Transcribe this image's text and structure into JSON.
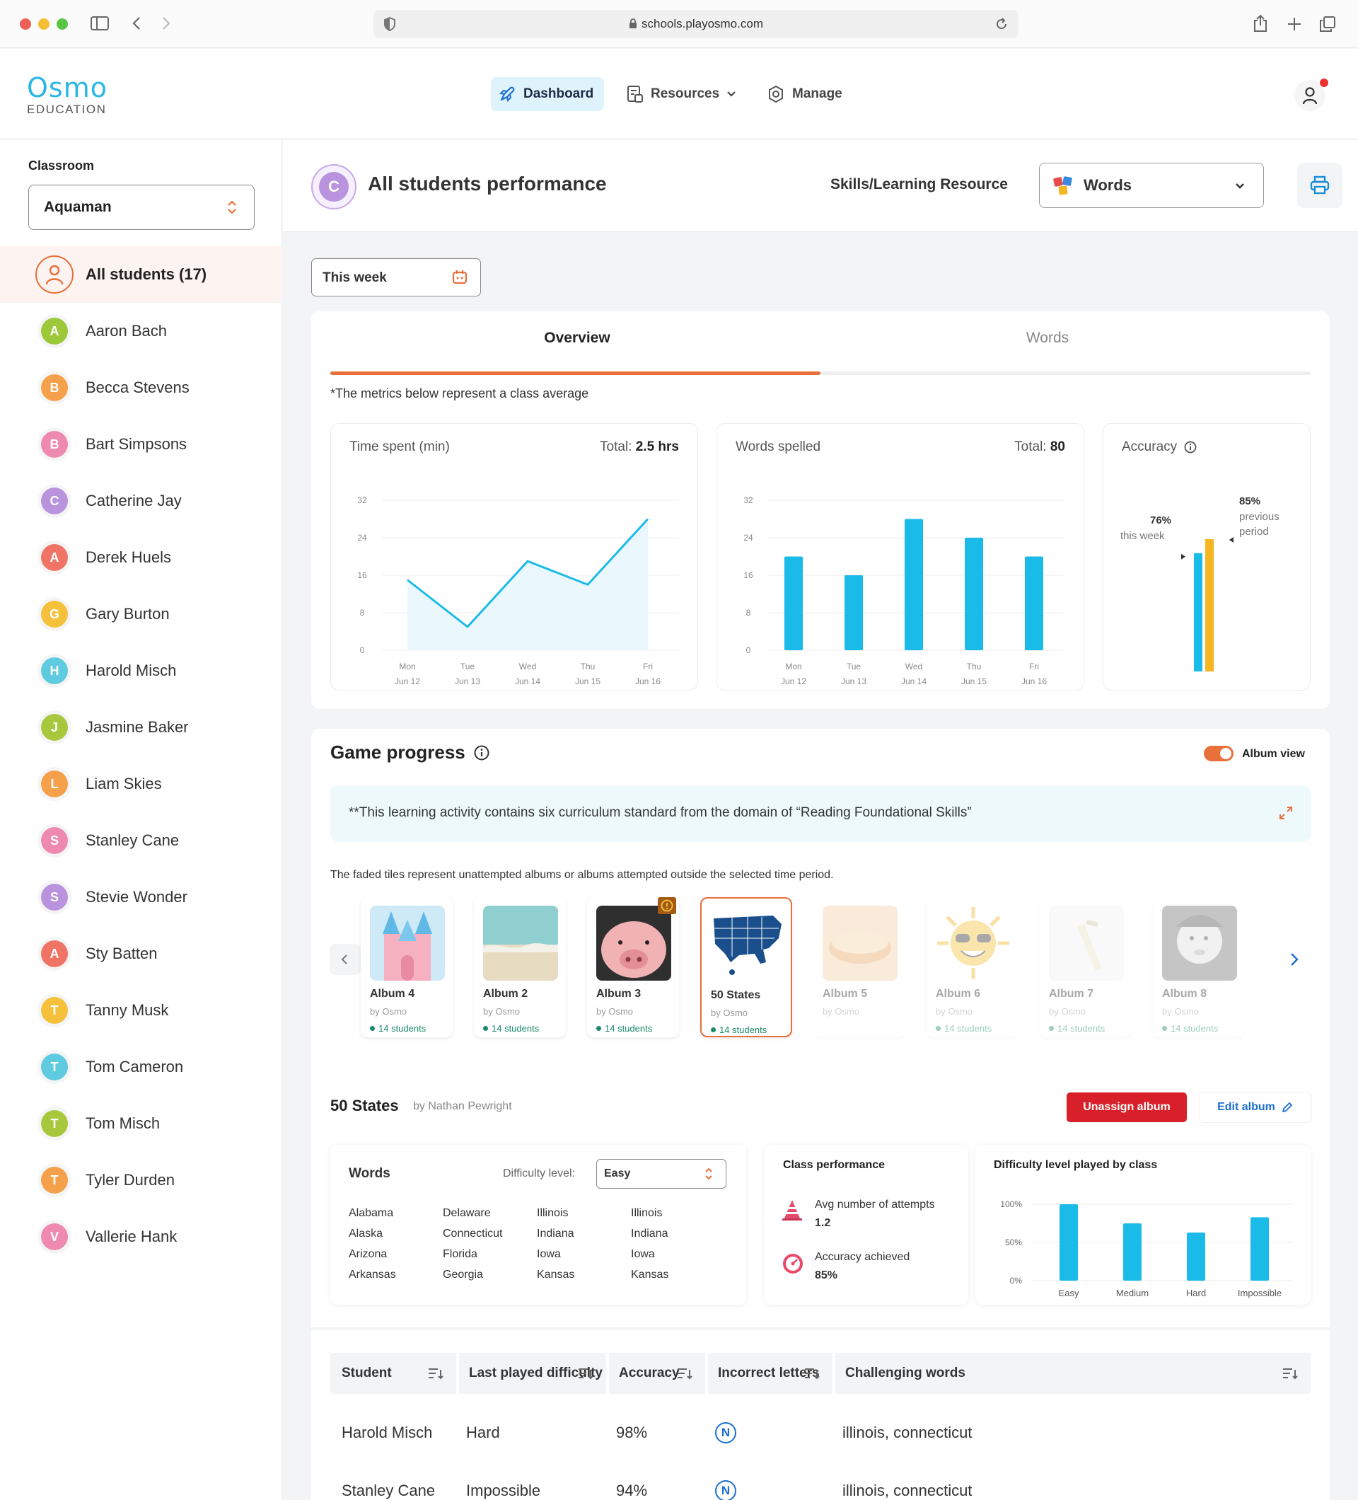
{
  "browser": {
    "url": "schools.playosmo.com"
  },
  "brand": {
    "logo_main": "Osmo",
    "logo_sub": "EDUCATION"
  },
  "nav": {
    "dashboard": "Dashboard",
    "resources": "Resources",
    "manage": "Manage"
  },
  "sidebar": {
    "classroom_label": "Classroom",
    "classroom_value": "Aquaman",
    "all_students": "All students (17)",
    "students": [
      {
        "initial": "A",
        "name": "Aaron Bach",
        "color": "#9cc93a"
      },
      {
        "initial": "B",
        "name": "Becca Stevens",
        "color": "#f5a04b"
      },
      {
        "initial": "B",
        "name": "Bart Simpsons",
        "color": "#ee8ab0"
      },
      {
        "initial": "C",
        "name": "Catherine Jay",
        "color": "#b993dd"
      },
      {
        "initial": "A",
        "name": "Derek Huels",
        "color": "#f07466"
      },
      {
        "initial": "G",
        "name": "Gary Burton",
        "color": "#f5c13b"
      },
      {
        "initial": "H",
        "name": "Harold Misch",
        "color": "#5fcbe0"
      },
      {
        "initial": "J",
        "name": "Jasmine Baker",
        "color": "#a7c83d"
      },
      {
        "initial": "L",
        "name": "Liam Skies",
        "color": "#f5a04b"
      },
      {
        "initial": "S",
        "name": "Stanley Cane",
        "color": "#ee8ab0"
      },
      {
        "initial": "S",
        "name": "Stevie Wonder",
        "color": "#b993dd"
      },
      {
        "initial": "A",
        "name": "Sty Batten",
        "color": "#f07466"
      },
      {
        "initial": "T",
        "name": "Tanny Musk",
        "color": "#f5c13b"
      },
      {
        "initial": "T",
        "name": "Tom Cameron",
        "color": "#5fcbe0"
      },
      {
        "initial": "T",
        "name": "Tom Misch",
        "color": "#a7c83d"
      },
      {
        "initial": "T",
        "name": "Tyler Durden",
        "color": "#f5a04b"
      },
      {
        "initial": "V",
        "name": "Vallerie Hank",
        "color": "#ee8ab0"
      }
    ]
  },
  "header": {
    "avatar_letter": "C",
    "title": "All students performance",
    "skills_label": "Skills/Learning Resource",
    "resource_value": "Words"
  },
  "period": {
    "label": "This week"
  },
  "tabs": {
    "overview": "Overview",
    "words": "Words",
    "note": "*The metrics below represent a class average"
  },
  "colors": {
    "accent": "#e8703a",
    "blue": "#1bbbe9",
    "yellow": "#f5b622",
    "red": "#d8202a",
    "link": "#1b6fd0"
  },
  "time_card": {
    "title": "Time spent (min)",
    "total_label": "Total:",
    "total_value": "2.5 hrs"
  },
  "words_card": {
    "title": "Words spelled",
    "total_label": "Total:",
    "total_value": "80"
  },
  "accuracy_card": {
    "title": "Accuracy",
    "this_pct": "76%",
    "this_label": "this week",
    "prev_pct": "85%",
    "prev_label_1": "previous",
    "prev_label_2": "period"
  },
  "chart_data": [
    {
      "type": "line",
      "title": "Time spent (min)",
      "categories": [
        "Mon",
        "Tue",
        "Wed",
        "Thu",
        "Fri"
      ],
      "dates": [
        "Jun 12",
        "Jun 13",
        "Jun 14",
        "Jun 15",
        "Jun 16"
      ],
      "values": [
        15,
        5,
        19,
        14,
        28
      ],
      "ylim": [
        0,
        32
      ],
      "yticks": [
        0,
        8,
        16,
        24,
        32
      ],
      "grid": true
    },
    {
      "type": "bar",
      "title": "Words spelled",
      "categories": [
        "Mon",
        "Tue",
        "Wed",
        "Thu",
        "Fri"
      ],
      "dates": [
        "Jun 12",
        "Jun 13",
        "Jun 14",
        "Jun 15",
        "Jun 16"
      ],
      "values": [
        20,
        16,
        28,
        24,
        20
      ],
      "ylim": [
        0,
        32
      ],
      "yticks": [
        0,
        8,
        16,
        24,
        32
      ],
      "grid": true
    },
    {
      "type": "bar",
      "title": "Accuracy",
      "categories": [
        "this week",
        "previous period"
      ],
      "values": [
        76,
        85
      ],
      "ylim": [
        0,
        100
      ]
    },
    {
      "type": "bar",
      "title": "Difficulty level played by class",
      "categories": [
        "Easy",
        "Medium",
        "Hard",
        "Impossible"
      ],
      "values": [
        100,
        75,
        63,
        83
      ],
      "ylim": [
        0,
        100
      ],
      "yticks": [
        "100%",
        "50%",
        "0%"
      ],
      "grid": true
    }
  ],
  "game": {
    "title": "Game progress",
    "album_view": "Album view",
    "banner": "**This learning activity contains six curriculum standard from the domain of “Reading Foundational Skills”",
    "faded_note": "The faded tiles represent unattempted albums or albums attempted outside the selected time period.",
    "albums": [
      {
        "name": "Album 4",
        "by": "by Osmo",
        "students": "14 students"
      },
      {
        "name": "Album 2",
        "by": "by Osmo",
        "students": "14 students"
      },
      {
        "name": "Album 3",
        "by": "by Osmo",
        "students": "14 students"
      },
      {
        "name": "50 States",
        "by": "by Osmo",
        "students": "14 students"
      },
      {
        "name": "Album 5",
        "by": "by Osmo",
        "students": ""
      },
      {
        "name": "Album 6",
        "by": "by Osmo",
        "students": "14 students"
      },
      {
        "name": "Album 7",
        "by": "by Osmo",
        "students": "14 students"
      },
      {
        "name": "Album 8",
        "by": "by Osmo",
        "students": "14 students"
      }
    ]
  },
  "album_detail": {
    "title": "50 States",
    "by": "by Nathan Pewright",
    "unassign": "Unassign album",
    "edit": "Edit album",
    "words_label": "Words",
    "difficulty_label": "Difficulty level:",
    "difficulty_value": "Easy",
    "words_cols": [
      [
        "Alabama",
        "Alaska",
        "Arizona",
        "Arkansas"
      ],
      [
        "Delaware",
        "Connecticut",
        "Florida",
        "Georgia"
      ],
      [
        "Illinois",
        "Indiana",
        "Iowa",
        "Kansas"
      ],
      [
        "Illinois",
        "Indiana",
        "Iowa",
        "Kansas"
      ]
    ],
    "class_perf_title": "Class performance",
    "avg_attempts_label": "Avg number of attempts",
    "avg_attempts_value": "1.2",
    "accuracy_label": "Accuracy achieved",
    "accuracy_value": "85%",
    "diff_chart_title": "Difficulty level played by class"
  },
  "table": {
    "headers": [
      "Student",
      "Last played difficulty",
      "Accuracy",
      "Incorrect letters",
      "Challenging words"
    ],
    "rows": [
      {
        "student": "Harold Misch",
        "difficulty": "Hard",
        "accuracy": "98%",
        "letter": "N",
        "words": "illinois, connecticut"
      },
      {
        "student": "Stanley Cane",
        "difficulty": "Impossible",
        "accuracy": "94%",
        "letter": "N",
        "words": "illinois, connecticut"
      }
    ]
  }
}
